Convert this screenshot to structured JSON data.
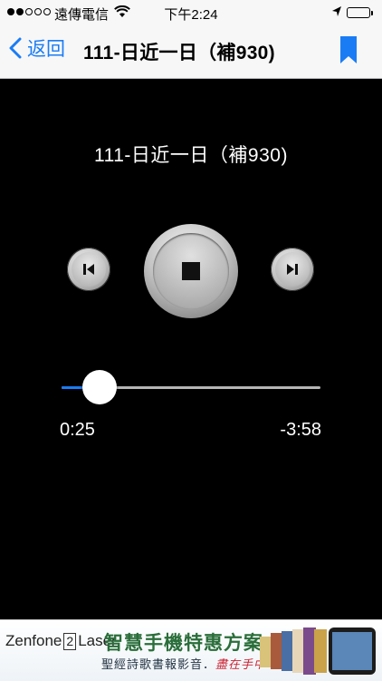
{
  "status_bar": {
    "carrier": "遠傳電信",
    "time": "下午2:24",
    "signal_bars_filled": 2,
    "signal_bars_total": 5,
    "battery_level": 1.0
  },
  "nav": {
    "back_label": "返回",
    "title": "111-日近一日（補930)",
    "accent_color": "#1a7cf5"
  },
  "player": {
    "track_title": "111-日近一日（補930)",
    "elapsed": "0:25",
    "remaining": "-3:58",
    "progress": 0.148,
    "icons": {
      "previous": "skip-previous-icon",
      "stop": "stop-icon",
      "next": "skip-next-icon"
    }
  },
  "ad": {
    "brand_left": "Zenfone",
    "brand_num": "2",
    "brand_right": "Laser",
    "headline": "智慧手機特惠方案",
    "subline": "聖經詩歌書報影音．",
    "subline_accent": "盡在手中"
  }
}
